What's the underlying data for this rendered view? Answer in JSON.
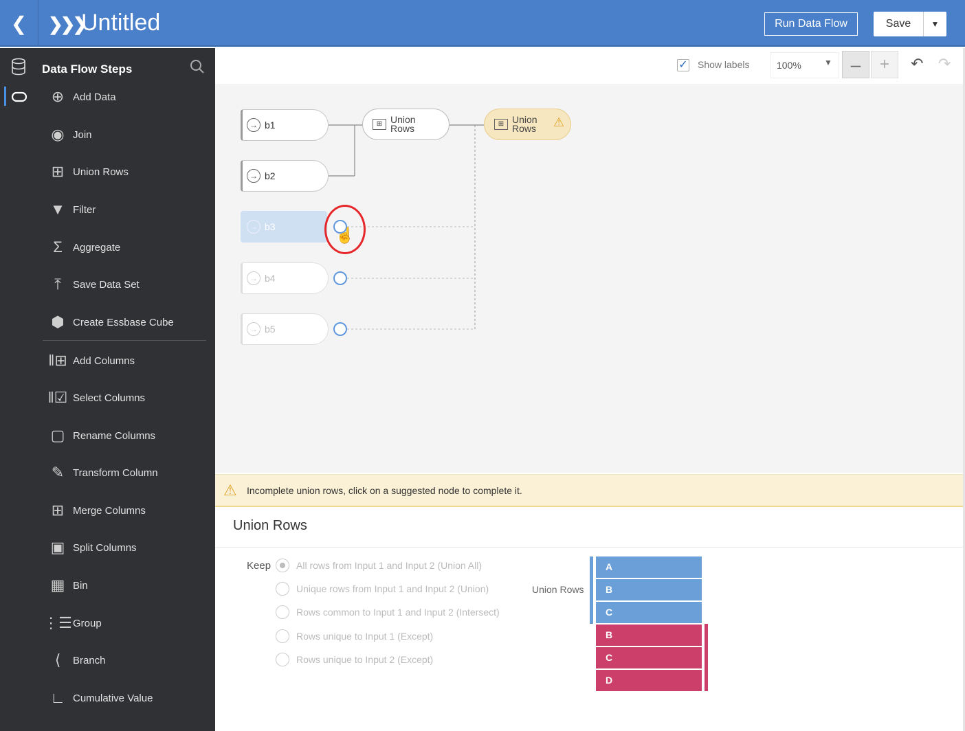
{
  "header": {
    "back_icon": "chevron-left-icon",
    "app_icon": "data-flow-icon",
    "title": "Untitled",
    "run_label": "Run Data Flow",
    "save_label": "Save"
  },
  "sidebar": {
    "title": "Data Flow Steps",
    "steps": [
      {
        "label": "Add Data",
        "icon": "add-data-icon"
      },
      {
        "label": "Join",
        "icon": "join-icon"
      },
      {
        "label": "Union Rows",
        "icon": "union-rows-icon"
      },
      {
        "label": "Filter",
        "icon": "filter-icon"
      },
      {
        "label": "Aggregate",
        "icon": "sigma-icon"
      },
      {
        "label": "Save Data Set",
        "icon": "upload-icon"
      },
      {
        "label": "Create Essbase Cube",
        "icon": "cube-icon"
      },
      {
        "label": "Add Columns",
        "icon": "add-columns-icon"
      },
      {
        "label": "Select Columns",
        "icon": "select-columns-icon"
      },
      {
        "label": "Rename Columns",
        "icon": "rename-columns-icon"
      },
      {
        "label": "Transform Column",
        "icon": "transform-column-icon"
      },
      {
        "label": "Merge Columns",
        "icon": "merge-columns-icon"
      },
      {
        "label": "Split Columns",
        "icon": "split-columns-icon"
      },
      {
        "label": "Bin",
        "icon": "bin-icon"
      },
      {
        "label": "Group",
        "icon": "group-icon"
      },
      {
        "label": "Branch",
        "icon": "branch-icon"
      },
      {
        "label": "Cumulative Value",
        "icon": "cumulative-icon"
      }
    ]
  },
  "toolbar": {
    "show_labels": "Show labels",
    "show_labels_checked": true,
    "zoom": "100%"
  },
  "canvas": {
    "nodes": [
      "b1",
      "b2",
      "b3",
      "b4",
      "b5"
    ],
    "union_node_1": "Union Rows",
    "union_node_2": "Union Rows"
  },
  "warning": {
    "message": "Incomplete union rows, click on a suggested node to complete it."
  },
  "properties": {
    "title": "Union Rows",
    "keep_label": "Keep",
    "options": [
      "All rows from Input 1 and Input 2 (Union All)",
      "Unique rows from Input 1 and Input 2 (Union)",
      "Rows common to Input 1 and Input 2 (Intersect)",
      "Rows unique to Input 1 (Except)",
      "Rows unique to Input 2 (Except)"
    ],
    "selected_option": 0,
    "diagram_label": "Union Rows",
    "input1_rows": [
      "A",
      "B",
      "C"
    ],
    "input2_rows": [
      "B",
      "C",
      "D"
    ],
    "colors": {
      "input1": "#6a9fd8",
      "input2": "#cc3f6b",
      "accent": "#4a7fc9",
      "warning": "#e0a32a"
    }
  }
}
